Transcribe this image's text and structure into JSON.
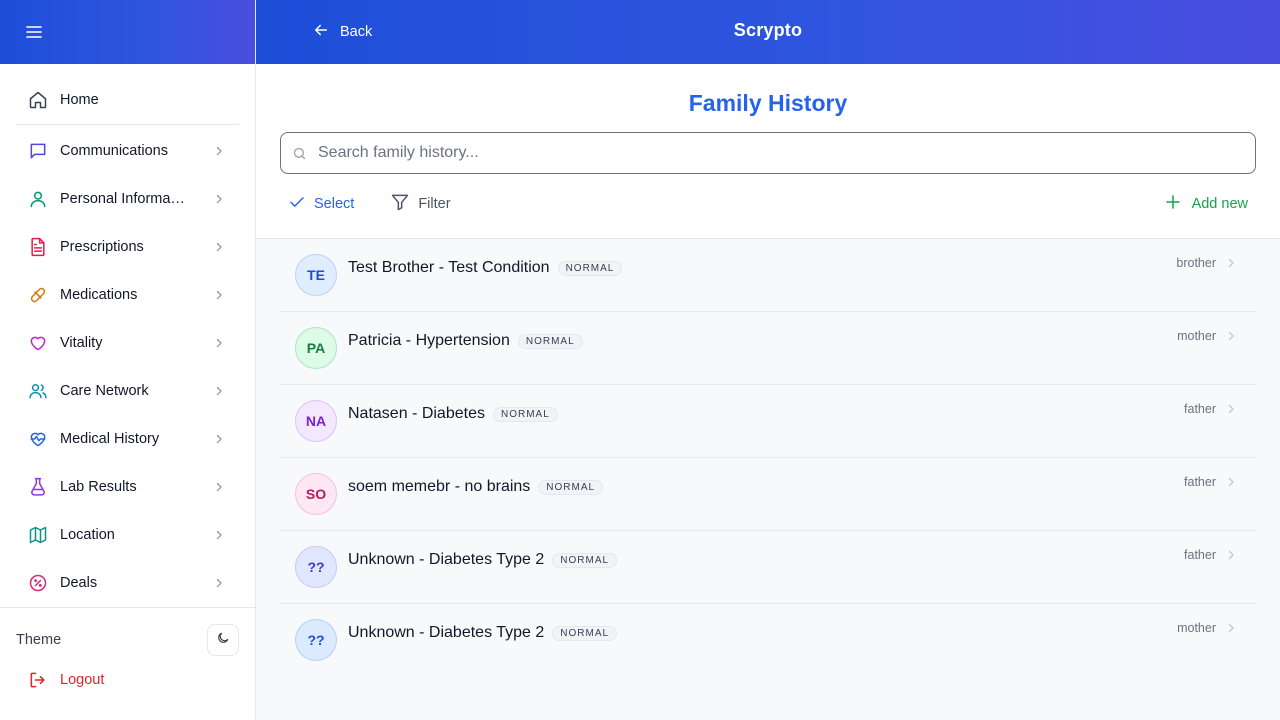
{
  "app": {
    "title": "Scrypto",
    "back_label": "Back"
  },
  "sidebar": {
    "home": {
      "label": "Home",
      "icon": "home-icon",
      "color": "#374151"
    },
    "items": [
      {
        "label": "Communications",
        "icon": "message-icon",
        "color": "#4f46e5"
      },
      {
        "label": "Personal Information",
        "icon": "user-icon",
        "color": "#059669"
      },
      {
        "label": "Prescriptions",
        "icon": "file-text-icon",
        "color": "#e11d48"
      },
      {
        "label": "Medications",
        "icon": "pill-icon",
        "color": "#d97706"
      },
      {
        "label": "Vitality",
        "icon": "heart-icon",
        "color": "#c026d3"
      },
      {
        "label": "Care Network",
        "icon": "users-icon",
        "color": "#0891b2"
      },
      {
        "label": "Medical History",
        "icon": "heart-pulse-icon",
        "color": "#2563eb"
      },
      {
        "label": "Lab Results",
        "icon": "flask-icon",
        "color": "#9333ea"
      },
      {
        "label": "Location",
        "icon": "map-icon",
        "color": "#0d9488"
      },
      {
        "label": "Deals",
        "icon": "badge-percent-icon",
        "color": "#db2777"
      }
    ],
    "theme_label": "Theme",
    "logout_label": "Logout"
  },
  "page": {
    "title": "Family History",
    "search": {
      "placeholder": "Search family history...",
      "value": ""
    },
    "toolbar": {
      "select_label": "Select",
      "filter_label": "Filter",
      "add_label": "Add new"
    }
  },
  "records": [
    {
      "initials": "TE",
      "name": "Test Brother - Test Condition",
      "status": "NORMAL",
      "relation": "brother",
      "avatar_bg": "#e0edff",
      "avatar_border": "#b9d3fb",
      "avatar_color": "#1d4ed8"
    },
    {
      "initials": "PA",
      "name": "Patricia - Hypertension",
      "status": "NORMAL",
      "relation": "mother",
      "avatar_bg": "#dcfce7",
      "avatar_border": "#a7e8c2",
      "avatar_color": "#15803d"
    },
    {
      "initials": "NA",
      "name": "Natasen - Diabetes",
      "status": "NORMAL",
      "relation": "father",
      "avatar_bg": "#f3e8ff",
      "avatar_border": "#dcc4f7",
      "avatar_color": "#7e22ce"
    },
    {
      "initials": "SO",
      "name": "soem memebr - no brains",
      "status": "NORMAL",
      "relation": "father",
      "avatar_bg": "#fce7f3",
      "avatar_border": "#f5c2dd",
      "avatar_color": "#be185d"
    },
    {
      "initials": "??",
      "name": "Unknown - Diabetes Type 2",
      "status": "NORMAL",
      "relation": "father",
      "avatar_bg": "#e0e7ff",
      "avatar_border": "#c3ccfa",
      "avatar_color": "#4338ca"
    },
    {
      "initials": "??",
      "name": "Unknown - Diabetes Type 2",
      "status": "NORMAL",
      "relation": "mother",
      "avatar_bg": "#dbeafe",
      "avatar_border": "#b7d2f8",
      "avatar_color": "#1d4ed8"
    }
  ]
}
